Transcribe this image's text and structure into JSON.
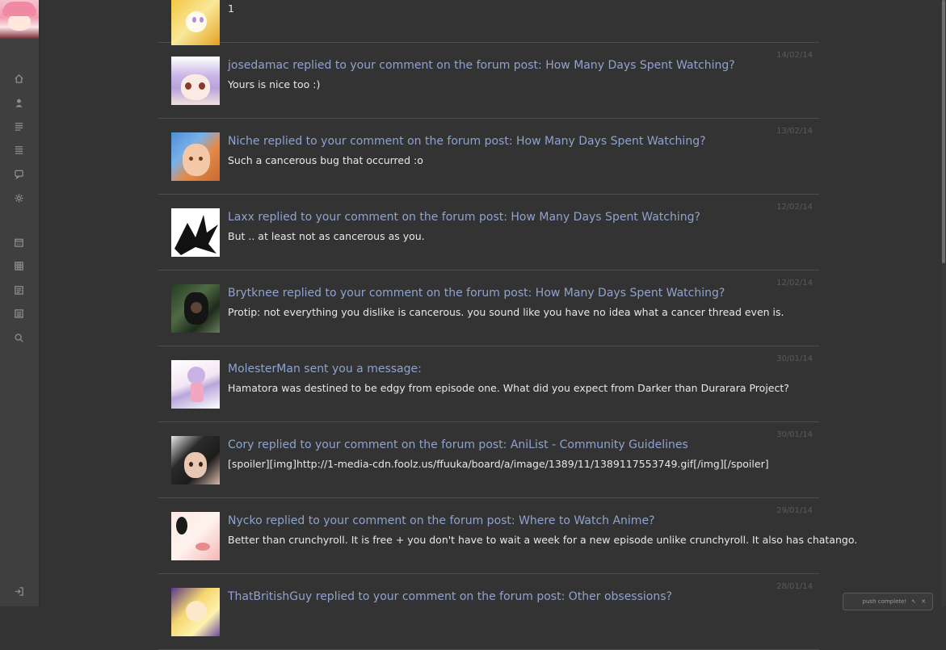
{
  "nav": {
    "items": [
      {
        "name": "home-icon"
      },
      {
        "name": "user-icon"
      },
      {
        "name": "list-icon"
      },
      {
        "name": "list-alt-icon"
      },
      {
        "name": "chat-icon"
      },
      {
        "name": "gear-icon"
      },
      {
        "name": "calendar-icon"
      },
      {
        "name": "grid-icon"
      },
      {
        "name": "checklist-icon"
      },
      {
        "name": "document-icon"
      },
      {
        "name": "search-icon"
      },
      {
        "name": "logout-icon"
      }
    ]
  },
  "feed": {
    "items": [
      {
        "title": "",
        "body": "1",
        "date": "",
        "thumb": "gold"
      },
      {
        "title": "josedamac replied to your comment on the forum post: How Many Days Spent Watching?",
        "body": "Yours is nice too :)",
        "date": "14/02/14",
        "thumb": "josedamac"
      },
      {
        "title": "Niche replied to your comment on the forum post: How Many Days Spent Watching?",
        "body": "Such a cancerous bug that occurred :o",
        "date": "13/02/14",
        "thumb": "niche"
      },
      {
        "title": "Laxx replied to your comment on the forum post: How Many Days Spent Watching?",
        "body": "But .. at least not as cancerous as you.",
        "date": "12/02/14",
        "thumb": "laxx"
      },
      {
        "title": "Brytknee replied to your comment on the forum post: How Many Days Spent Watching?",
        "body": "Protip: not everything you dislike is cancerous. you sound like you have no idea what a cancer thread even is.",
        "date": "12/02/14",
        "thumb": "brytknee"
      },
      {
        "title": "MolesterMan sent you a message:",
        "body": "Hamatora was destined to be edgy from episode one. What did you expect from Darker than Durarara Project?",
        "date": "30/01/14",
        "thumb": "molester"
      },
      {
        "title": "Cory replied to your comment on the forum post: AniList - Community Guidelines",
        "body": "[spoiler][img]http://1-media-cdn.foolz.us/ffuuka/board/a/image/1389/11/1389117553749.gif[/img][/spoiler]",
        "date": "30/01/14",
        "thumb": "cory"
      },
      {
        "title": "Nycko replied to your comment on the forum post: Where to Watch Anime?",
        "body": "Better than crunchyroll. It is free + you don't have to wait a week for a new episode unlike crunchyroll. It also has chatango.",
        "date": "29/01/14",
        "thumb": "nycko"
      },
      {
        "title": "ThatBritishGuy replied to your comment on the forum post: Other obsessions?",
        "body": "",
        "date": "28/01/14",
        "thumb": "british"
      }
    ]
  },
  "notification": {
    "text": "push complete!",
    "icon_a": "↖",
    "icon_b": "✕"
  }
}
